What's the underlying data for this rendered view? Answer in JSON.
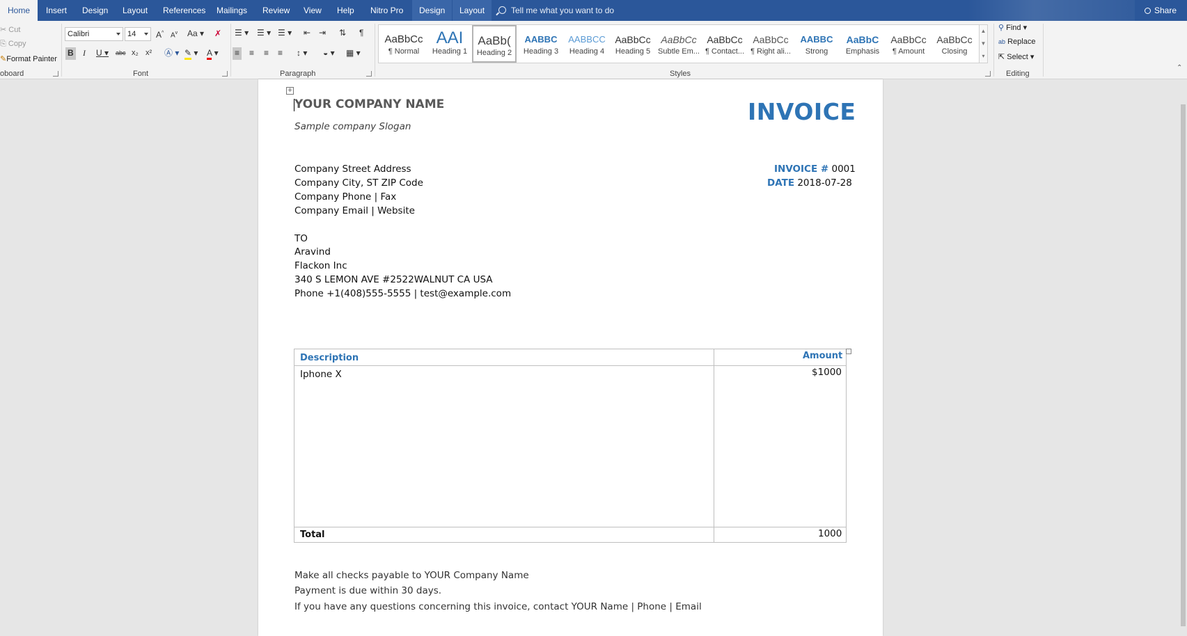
{
  "tabs": [
    "Home",
    "Insert",
    "Design",
    "Layout",
    "References",
    "Mailings",
    "Review",
    "View",
    "Help",
    "Nitro Pro",
    "Design",
    "Layout"
  ],
  "tell_me": "Tell me what you want to do",
  "share": "Share",
  "clipboard": {
    "cut": "Cut",
    "copy": "Copy",
    "format_painter": "Format Painter",
    "label": "oboard"
  },
  "font": {
    "family": "Calibri",
    "size": "14",
    "grow": "A",
    "shrink": "A",
    "change_case": "Aa",
    "bold": "B",
    "italic": "I",
    "underline": "U",
    "strike": "abc",
    "subscript": "x₂",
    "superscript": "x²",
    "label": "Font"
  },
  "paragraph": {
    "label": "Paragraph"
  },
  "styles": {
    "label": "Styles",
    "items": [
      {
        "preview": "AaBbCc",
        "name": "¶ Normal"
      },
      {
        "preview": "AAI",
        "name": "Heading 1"
      },
      {
        "preview": "AaBb(",
        "name": "Heading 2"
      },
      {
        "preview": "AABBC",
        "name": "Heading 3"
      },
      {
        "preview": "AABBCC",
        "name": "Heading 4"
      },
      {
        "preview": "AaBbCc",
        "name": "Heading 5"
      },
      {
        "preview": "AaBbCc",
        "name": "Subtle Em..."
      },
      {
        "preview": "AaBbCc",
        "name": "¶ Contact..."
      },
      {
        "preview": "AaBbCc",
        "name": "¶ Right ali..."
      },
      {
        "preview": "AABBC",
        "name": "Strong"
      },
      {
        "preview": "AaBbC",
        "name": "Emphasis"
      },
      {
        "preview": "AaBbCc",
        "name": "¶ Amount"
      },
      {
        "preview": "AaBbCc",
        "name": "Closing"
      }
    ]
  },
  "editing": {
    "find": "Find",
    "replace": "Replace",
    "select": "Select",
    "label": "Editing"
  },
  "doc": {
    "company_name": "YOUR COMPANY NAME",
    "slogan": "Sample company Slogan",
    "invoice_title": "INVOICE",
    "address": [
      "Company Street Address",
      "Company City, ST ZIP Code",
      "Company Phone  | Fax",
      "Company Email | Website"
    ],
    "invoice_no_label": "INVOICE #",
    "invoice_no": "0001",
    "date_label": "DATE",
    "date": "2018-07-28",
    "to_label": "TO",
    "client": [
      "Aravind",
      "Flackon Inc",
      "340 S LEMON AVE #2522WALNUT CA USA",
      "Phone +1(408)555-5555 | test@example.com"
    ],
    "table": {
      "col_desc": "Description",
      "col_amount": "Amount",
      "row_desc": "Iphone X",
      "row_amount": "$1000",
      "total_label": "Total",
      "total_value": "1000"
    },
    "notes": [
      "Make all checks payable to YOUR Company Name",
      "Payment is due within 30 days.",
      "If you have any questions concerning this invoice, contact YOUR Name | Phone | Email"
    ]
  }
}
